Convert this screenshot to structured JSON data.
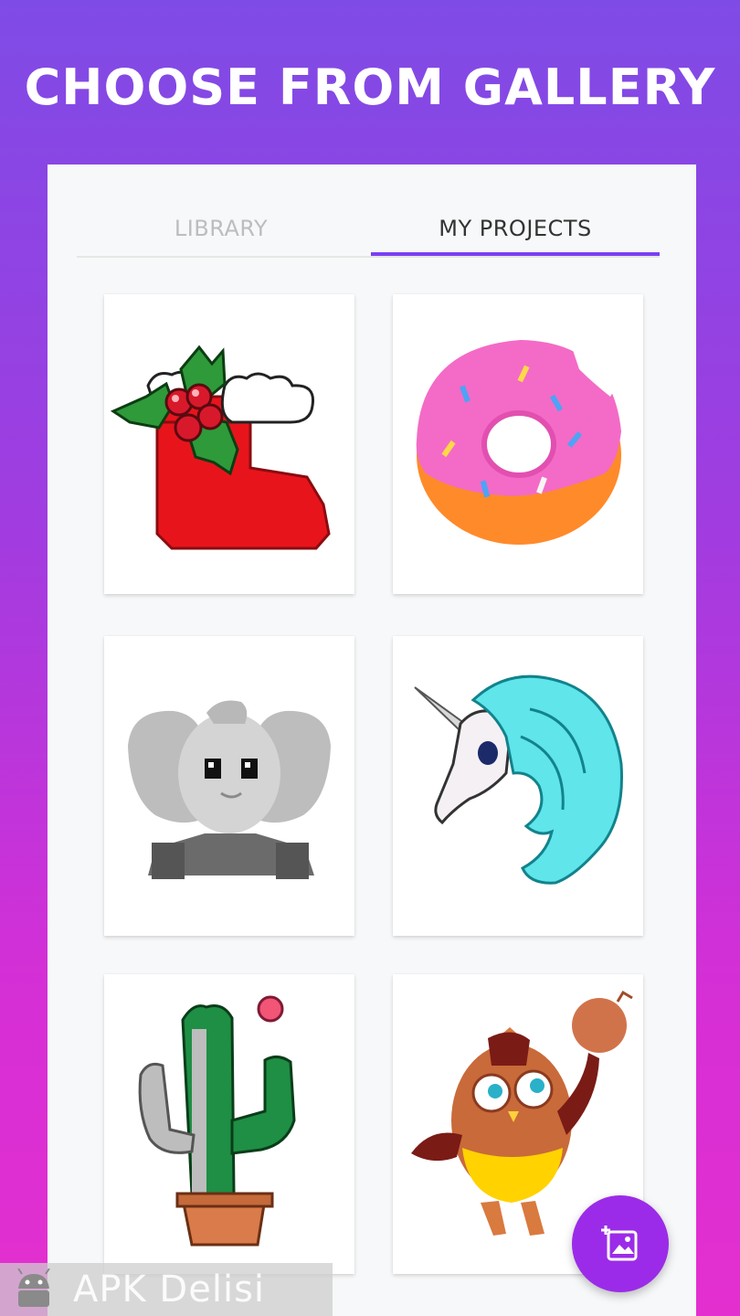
{
  "headline": "CHOOSE FROM GALLERY",
  "tabs": {
    "library": "LIBRARY",
    "my_projects": "MY PROJECTS",
    "selected": "MY PROJECTS"
  },
  "gallery": {
    "items": [
      {
        "subject": "christmas-stocking"
      },
      {
        "subject": "donut"
      },
      {
        "subject": "elephant"
      },
      {
        "subject": "unicorn"
      },
      {
        "subject": "cactus"
      },
      {
        "subject": "owl-basketball"
      }
    ]
  },
  "fab": {
    "icon": "add-image-icon"
  },
  "watermark": {
    "text": "APK Delisi"
  },
  "colors": {
    "accent": "#7b3ff2",
    "fab": "#9b2be8",
    "tab_active": "#333333",
    "tab_inactive": "#bdbdbd"
  }
}
